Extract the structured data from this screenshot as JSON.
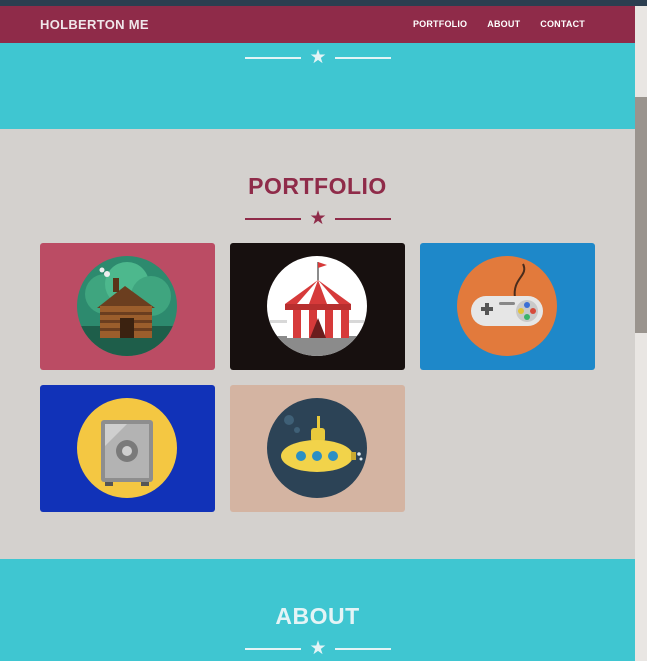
{
  "navbar": {
    "brand": "HOLBERTON ME",
    "links": [
      "PORTFOLIO",
      "ABOUT",
      "CONTACT"
    ]
  },
  "portfolio": {
    "title": "PORTFOLIO",
    "items": [
      {
        "icon": "log-cabin-icon",
        "bg": "#bb4c64",
        "circle": "#2d8a6e"
      },
      {
        "icon": "circus-tent-icon",
        "bg": "#17100f",
        "circle": "#ffffff"
      },
      {
        "icon": "game-controller-icon",
        "bg": "#1e88c9",
        "circle": "#e27a3c"
      },
      {
        "icon": "safe-icon",
        "bg": "#1132b8",
        "circle": "#f4c742"
      },
      {
        "icon": "submarine-icon",
        "bg": "#d4b4a2",
        "circle": "#2c4356"
      }
    ]
  },
  "about": {
    "title": "ABOUT"
  },
  "colors": {
    "accent": "#8f2b49",
    "teal": "#3fc6d1",
    "light": "#d4d1ce"
  }
}
